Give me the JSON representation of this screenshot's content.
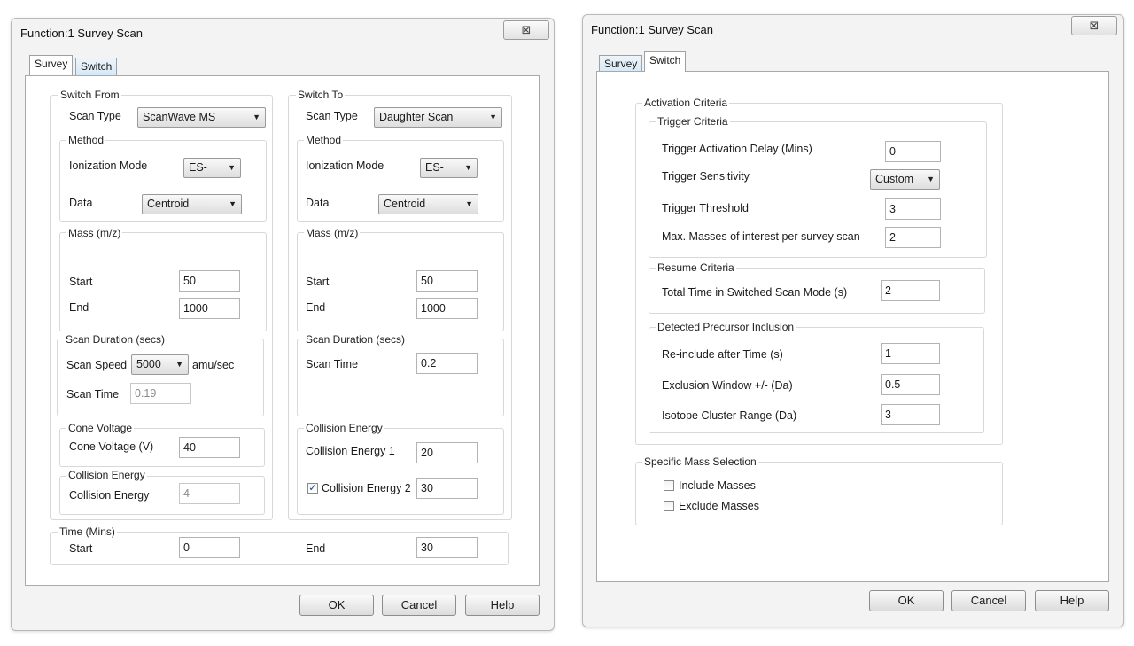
{
  "left": {
    "title": "Function:1 Survey Scan",
    "close_glyph": "⊠",
    "tabs": [
      "Survey",
      "Switch"
    ],
    "switch_from": {
      "legend": "Switch From",
      "scan_type_label": "Scan Type",
      "scan_type_value": "ScanWave MS",
      "method_legend": "Method",
      "ionization_label": "Ionization Mode",
      "ionization_value": "ES-",
      "data_label": "Data",
      "data_value": "Centroid",
      "mass_legend": "Mass (m/z)",
      "start_label": "Start",
      "start_value": "50",
      "end_label": "End",
      "end_value": "1000",
      "scan_duration_legend": "Scan Duration (secs)",
      "scan_speed_label": "Scan Speed",
      "scan_speed_value": "5000",
      "scan_speed_unit": "amu/sec",
      "scan_time_label": "Scan Time",
      "scan_time_value": "0.19",
      "cone_legend": "Cone Voltage",
      "cone_label": "Cone Voltage (V)",
      "cone_value": "40",
      "collision_legend": "Collision Energy",
      "collision_label": "Collision Energy",
      "collision_value": "4"
    },
    "switch_to": {
      "legend": "Switch To",
      "scan_type_label": "Scan Type",
      "scan_type_value": "Daughter Scan",
      "method_legend": "Method",
      "ionization_label": "Ionization Mode",
      "ionization_value": "ES-",
      "data_label": "Data",
      "data_value": "Centroid",
      "mass_legend": "Mass (m/z)",
      "start_label": "Start",
      "start_value": "50",
      "end_label": "End",
      "end_value": "1000",
      "scan_duration_legend": "Scan Duration (secs)",
      "scan_time_label": "Scan Time",
      "scan_time_value": "0.2",
      "collision_legend": "Collision Energy",
      "ce1_label": "Collision Energy 1",
      "ce1_value": "20",
      "ce2_label": "Collision Energy 2",
      "ce2_value": "30",
      "ce2_checked": true
    },
    "time": {
      "legend": "Time (Mins)",
      "start_label": "Start",
      "start_value": "0",
      "end_label": "End",
      "end_value": "30"
    },
    "buttons": {
      "ok": "OK",
      "cancel": "Cancel",
      "help": "Help"
    }
  },
  "right": {
    "title": "Function:1 Survey Scan",
    "close_glyph": "⊠",
    "tabs": [
      "Survey",
      "Switch"
    ],
    "activation": {
      "legend": "Activation Criteria",
      "trigger_legend": "Trigger Criteria",
      "delay_label": "Trigger Activation Delay (Mins)",
      "delay_value": "0",
      "sensitivity_label": "Trigger Sensitivity",
      "sensitivity_value": "Custom",
      "threshold_label": "Trigger Threshold",
      "threshold_value": "3",
      "max_masses_label": "Max. Masses of interest per survey scan",
      "max_masses_value": "2",
      "resume_legend": "Resume Criteria",
      "total_time_label": "Total Time in Switched Scan Mode (s)",
      "total_time_value": "2",
      "precursor_legend": "Detected Precursor Inclusion",
      "reinclude_label": "Re-include after Time (s)",
      "reinclude_value": "1",
      "exclusion_label": "Exclusion Window +/- (Da)",
      "exclusion_value": "0.5",
      "isotope_label": "Isotope Cluster Range (Da)",
      "isotope_value": "3"
    },
    "specific": {
      "legend": "Specific Mass Selection",
      "include_label": "Include Masses",
      "exclude_label": "Exclude Masses"
    },
    "buttons": {
      "ok": "OK",
      "cancel": "Cancel",
      "help": "Help"
    }
  }
}
